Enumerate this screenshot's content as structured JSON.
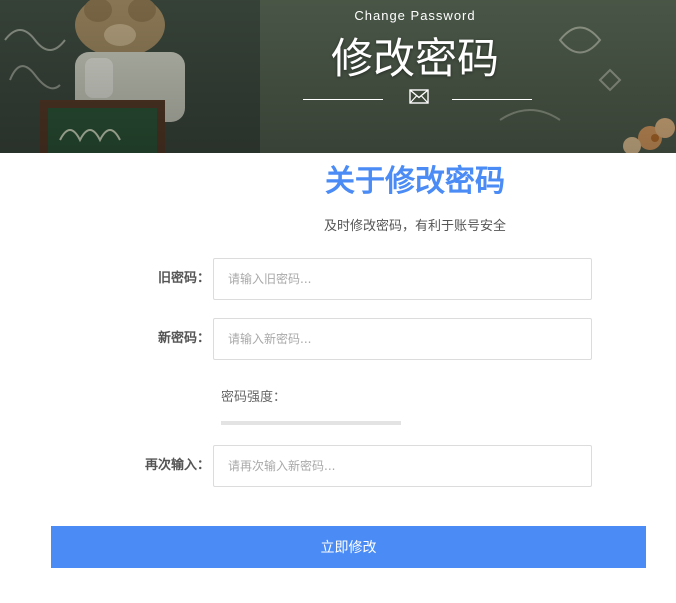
{
  "banner": {
    "subtitle": "Change Password",
    "title": "修改密码",
    "icon": "mail-icon"
  },
  "intro": {
    "title": "关于修改密码",
    "description": "及时修改密码，有利于账号安全"
  },
  "form": {
    "old_password": {
      "label": "旧密码：",
      "placeholder": "请输入旧密码..."
    },
    "new_password": {
      "label": "新密码：",
      "placeholder": "请输入新密码..."
    },
    "strength": {
      "label": "密码强度：",
      "level": 0
    },
    "confirm_password": {
      "label": "再次输入：",
      "placeholder": "请再次输入新密码..."
    },
    "submit_label": "立即修改"
  },
  "colors": {
    "accent": "#4a8bf5",
    "banner_text": "#ffffff"
  }
}
